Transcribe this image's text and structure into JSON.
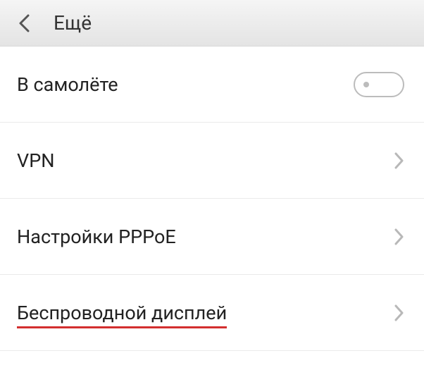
{
  "header": {
    "title": "Ещё"
  },
  "items": [
    {
      "label": "В самолёте",
      "type": "toggle",
      "toggled": false
    },
    {
      "label": "VPN",
      "type": "link"
    },
    {
      "label": "Настройки PPPoE",
      "type": "link"
    },
    {
      "label": "Беспроводной дисплей",
      "type": "link",
      "highlighted": true
    }
  ],
  "colors": {
    "highlight": "#d32f2f",
    "text": "#222222",
    "chevron": "#b8b8b8",
    "toggle_border": "#bcbcbc"
  }
}
